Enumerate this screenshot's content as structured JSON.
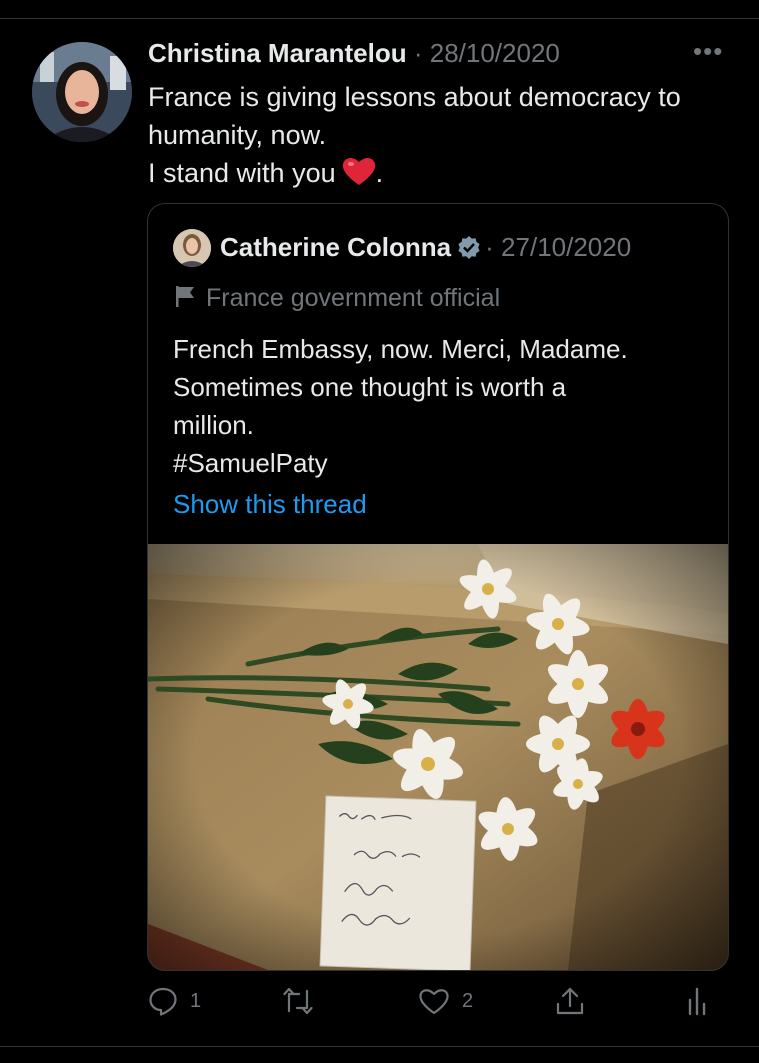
{
  "tweet": {
    "author_name": "Christina Marantelou",
    "separator": "·",
    "date": "28/10/2020",
    "more_label": "•••",
    "text_lines": [
      "France is giving lessons about democracy to",
      "humanity, now.",
      "I stand with you"
    ],
    "text_end": ".",
    "emoji": "heart-emoji"
  },
  "quote": {
    "author_name": "Catherine Colonna",
    "separator": "·",
    "date": "27/10/2020",
    "label": "France government official",
    "text_lines": [
      "French Embassy, now. Merci, Madame.",
      "Sometimes one thought is worth a",
      "million.",
      "#SamuelPaty"
    ],
    "thread_link": "Show this thread"
  },
  "actions": {
    "reply_count": "1",
    "like_count": "2"
  },
  "colors": {
    "background": "#000000",
    "text": "#e7e9ea",
    "muted": "#71767b",
    "link": "#1d9bf0",
    "border": "#2f3336"
  }
}
